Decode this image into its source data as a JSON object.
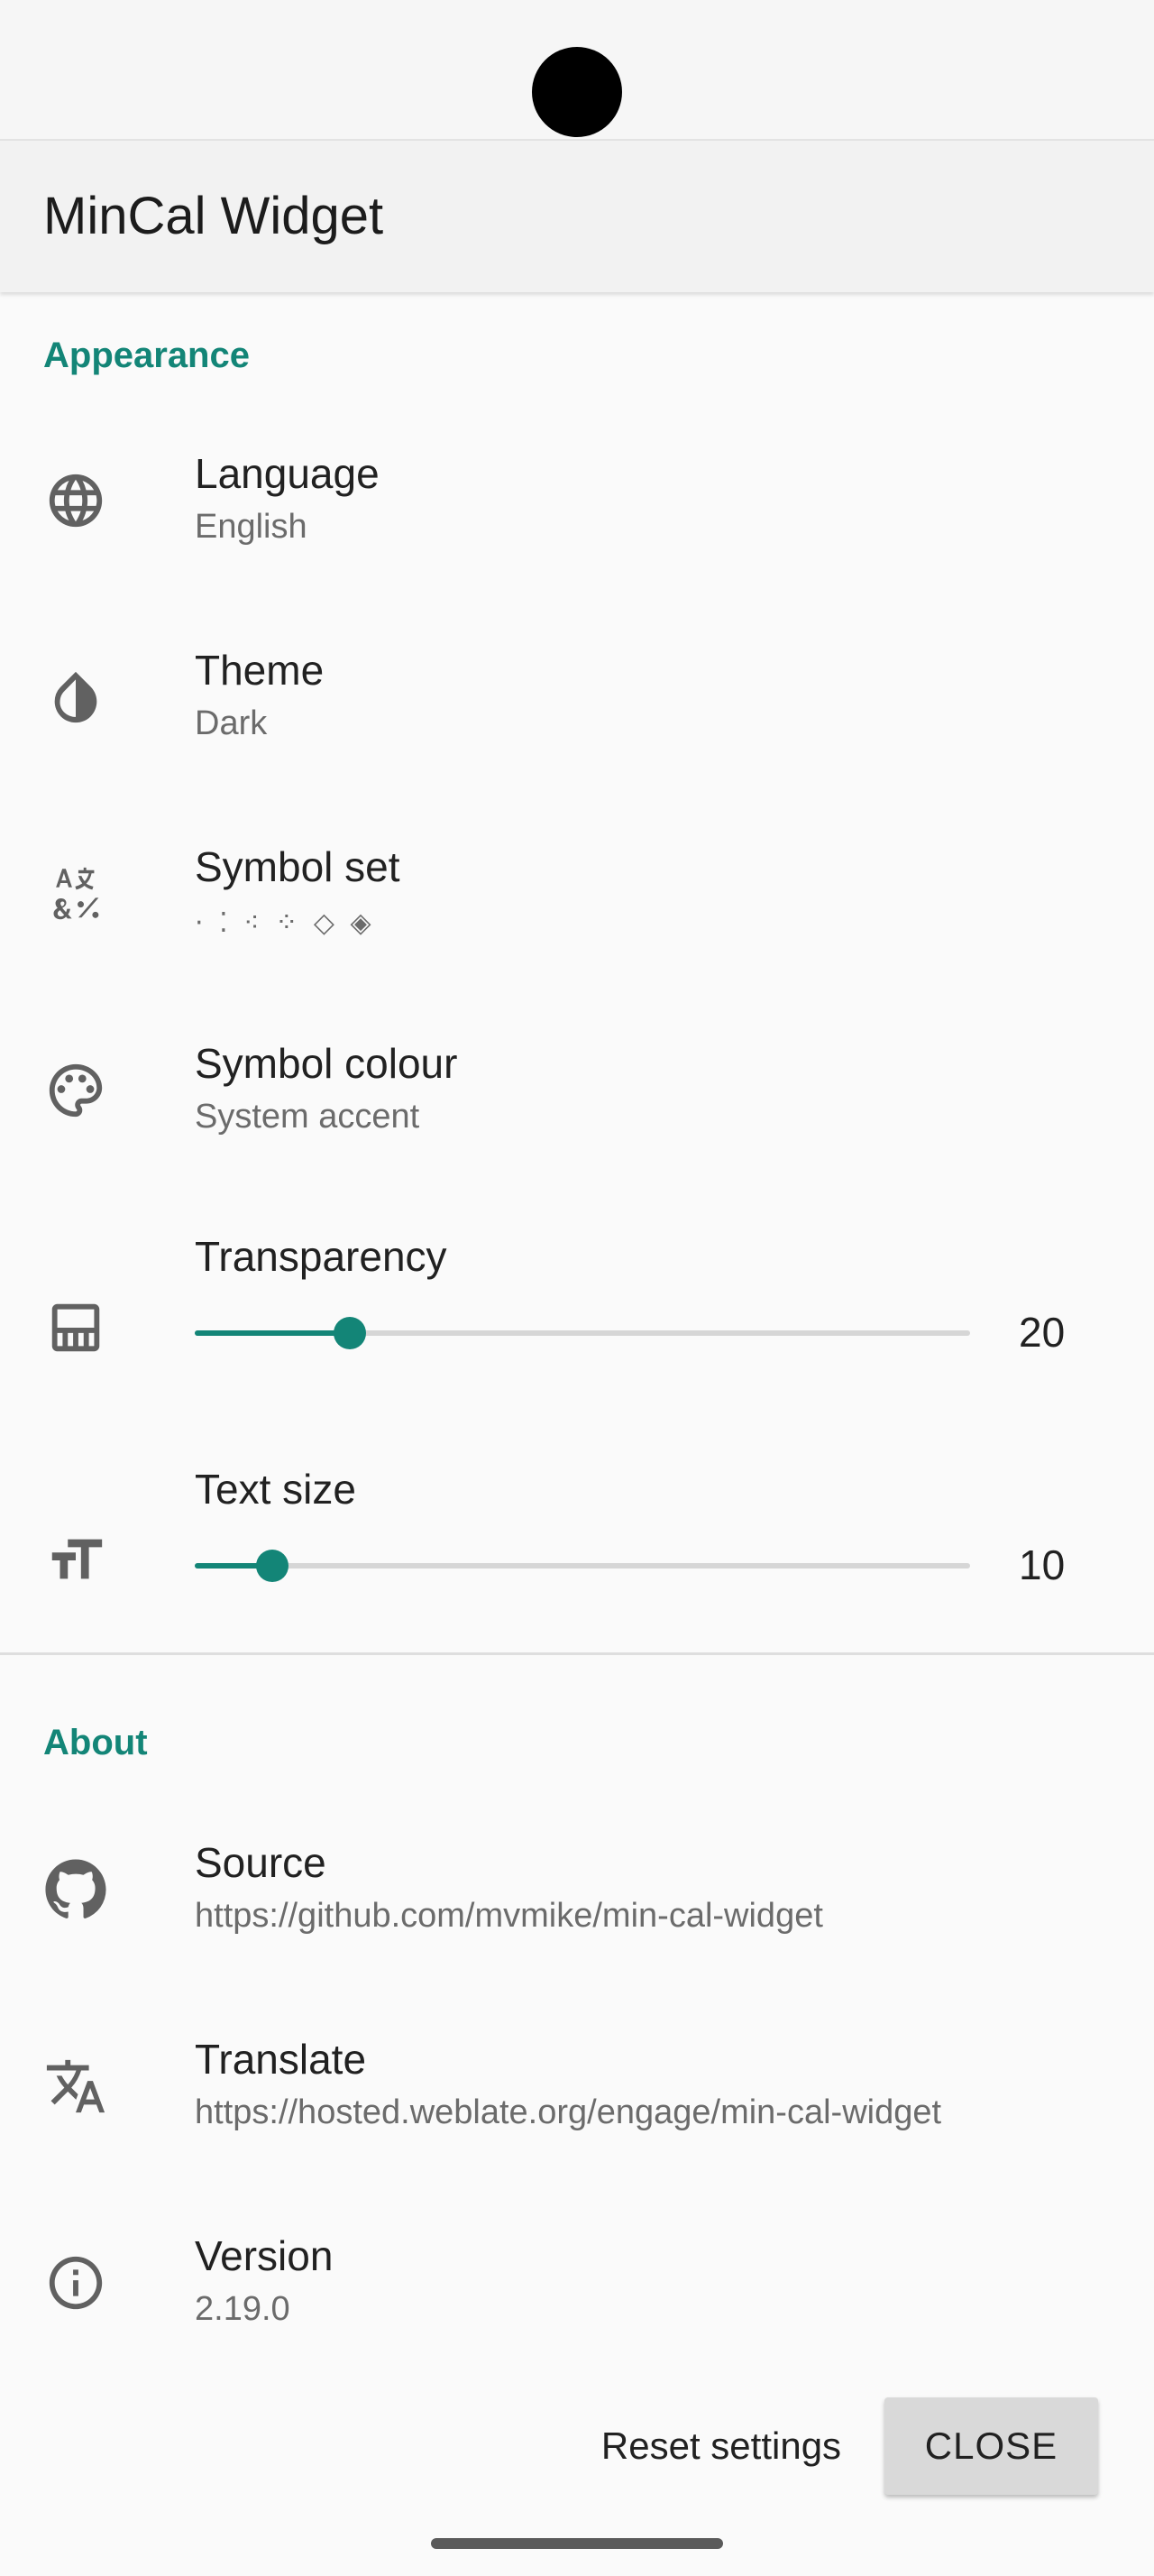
{
  "app_title": "MinCal Widget",
  "sections": {
    "appearance": "Appearance",
    "about": "About"
  },
  "appearance": {
    "language": {
      "title": "Language",
      "summary": "English",
      "icon": "globe-icon"
    },
    "theme": {
      "title": "Theme",
      "summary": "Dark",
      "icon": "contrast-drop-icon"
    },
    "symbol_set": {
      "title": "Symbol set",
      "summary": "· ⁚ ⁖ ⁘ ◇ ◈",
      "icon": "symbols-icon"
    },
    "symbol_colour": {
      "title": "Symbol colour",
      "summary": "System accent",
      "icon": "palette-icon"
    },
    "transparency": {
      "title": "Transparency",
      "value": "20",
      "fraction": 0.2,
      "icon": "transparency-icon"
    },
    "text_size": {
      "title": "Text size",
      "value": "10",
      "fraction": 0.1,
      "icon": "text-size-icon"
    }
  },
  "about": {
    "source": {
      "title": "Source",
      "summary": "https://github.com/mvmike/min-cal-widget",
      "icon": "github-icon"
    },
    "translate": {
      "title": "Translate",
      "summary": "https://hosted.weblate.org/engage/min-cal-widget",
      "icon": "translate-icon"
    },
    "version": {
      "title": "Version",
      "summary": "2.19.0",
      "icon": "info-icon"
    }
  },
  "buttons": {
    "reset": "Reset settings",
    "close": "CLOSE"
  },
  "colors": {
    "accent": "#138577",
    "background": "#fafafa"
  }
}
